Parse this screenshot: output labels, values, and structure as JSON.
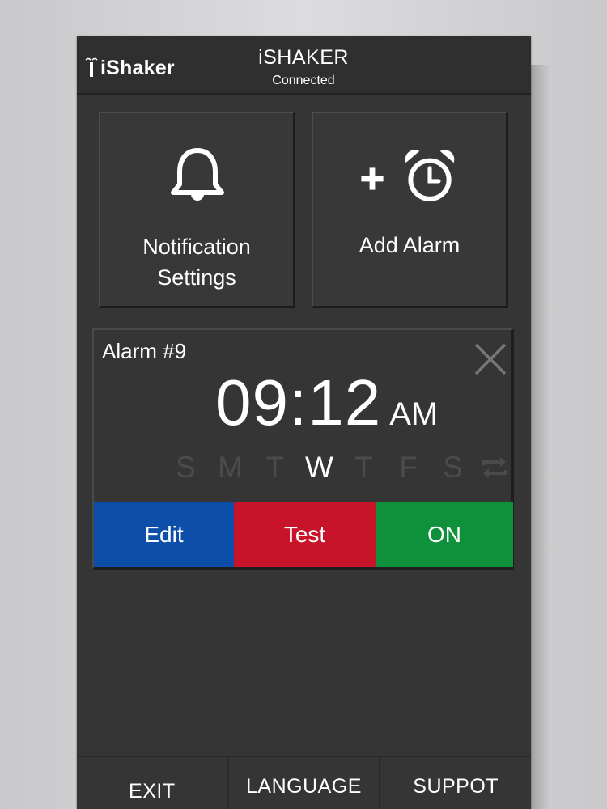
{
  "header": {
    "logo_text": "iShaker",
    "title": "iSHAKER",
    "status": "Connected"
  },
  "tiles": {
    "notification": {
      "line1": "Notification",
      "line2": "Settings",
      "icon": "bell-icon"
    },
    "add_alarm": {
      "label": "Add Alarm",
      "icon": "add-alarm-clock-icon"
    }
  },
  "alarm": {
    "name": "Alarm #9",
    "time": "09:12",
    "ampm": "AM",
    "days": [
      {
        "label": "S",
        "active": false
      },
      {
        "label": "M",
        "active": false
      },
      {
        "label": "T",
        "active": false
      },
      {
        "label": "W",
        "active": true
      },
      {
        "label": "T",
        "active": false
      },
      {
        "label": "F",
        "active": false
      },
      {
        "label": "S",
        "active": false
      }
    ],
    "repeat_active": false,
    "buttons": {
      "edit": "Edit",
      "test": "Test",
      "on": "ON"
    }
  },
  "nav": {
    "exit": "EXIT",
    "language": "LANGUAGE",
    "support": "SUPPOT"
  },
  "colors": {
    "edit": "#0d4fa8",
    "test": "#c8142a",
    "on": "#0e913a",
    "day_inactive": "#4b4b4b",
    "day_active": "#ffffff"
  }
}
